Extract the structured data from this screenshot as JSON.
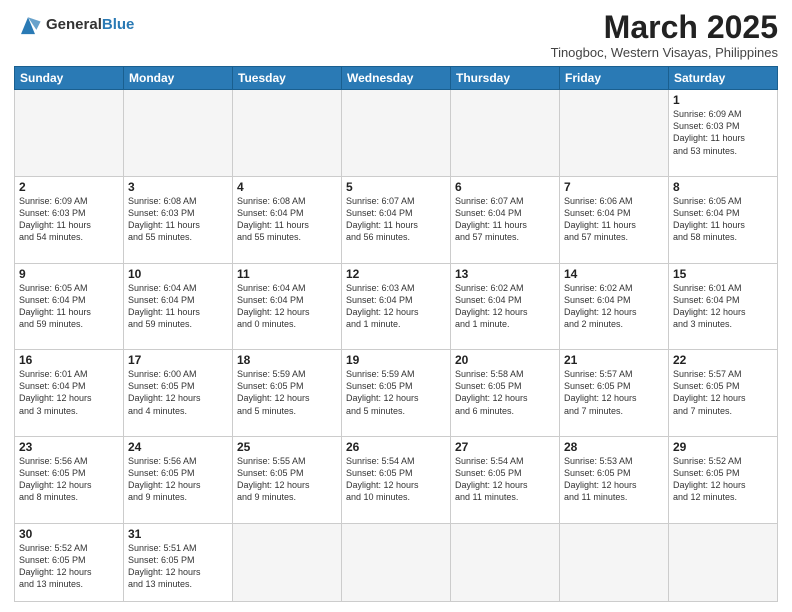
{
  "header": {
    "logo_text_normal": "General",
    "logo_text_blue": "Blue",
    "month_title": "March 2025",
    "subtitle": "Tinogboc, Western Visayas, Philippines"
  },
  "weekdays": [
    "Sunday",
    "Monday",
    "Tuesday",
    "Wednesday",
    "Thursday",
    "Friday",
    "Saturday"
  ],
  "weeks": [
    [
      {
        "day": "",
        "info": ""
      },
      {
        "day": "",
        "info": ""
      },
      {
        "day": "",
        "info": ""
      },
      {
        "day": "",
        "info": ""
      },
      {
        "day": "",
        "info": ""
      },
      {
        "day": "",
        "info": ""
      },
      {
        "day": "1",
        "info": "Sunrise: 6:09 AM\nSunset: 6:03 PM\nDaylight: 11 hours\nand 53 minutes."
      }
    ],
    [
      {
        "day": "2",
        "info": "Sunrise: 6:09 AM\nSunset: 6:03 PM\nDaylight: 11 hours\nand 54 minutes."
      },
      {
        "day": "3",
        "info": "Sunrise: 6:08 AM\nSunset: 6:03 PM\nDaylight: 11 hours\nand 55 minutes."
      },
      {
        "day": "4",
        "info": "Sunrise: 6:08 AM\nSunset: 6:04 PM\nDaylight: 11 hours\nand 55 minutes."
      },
      {
        "day": "5",
        "info": "Sunrise: 6:07 AM\nSunset: 6:04 PM\nDaylight: 11 hours\nand 56 minutes."
      },
      {
        "day": "6",
        "info": "Sunrise: 6:07 AM\nSunset: 6:04 PM\nDaylight: 11 hours\nand 57 minutes."
      },
      {
        "day": "7",
        "info": "Sunrise: 6:06 AM\nSunset: 6:04 PM\nDaylight: 11 hours\nand 57 minutes."
      },
      {
        "day": "8",
        "info": "Sunrise: 6:05 AM\nSunset: 6:04 PM\nDaylight: 11 hours\nand 58 minutes."
      }
    ],
    [
      {
        "day": "9",
        "info": "Sunrise: 6:05 AM\nSunset: 6:04 PM\nDaylight: 11 hours\nand 59 minutes."
      },
      {
        "day": "10",
        "info": "Sunrise: 6:04 AM\nSunset: 6:04 PM\nDaylight: 11 hours\nand 59 minutes."
      },
      {
        "day": "11",
        "info": "Sunrise: 6:04 AM\nSunset: 6:04 PM\nDaylight: 12 hours\nand 0 minutes."
      },
      {
        "day": "12",
        "info": "Sunrise: 6:03 AM\nSunset: 6:04 PM\nDaylight: 12 hours\nand 1 minute."
      },
      {
        "day": "13",
        "info": "Sunrise: 6:02 AM\nSunset: 6:04 PM\nDaylight: 12 hours\nand 1 minute."
      },
      {
        "day": "14",
        "info": "Sunrise: 6:02 AM\nSunset: 6:04 PM\nDaylight: 12 hours\nand 2 minutes."
      },
      {
        "day": "15",
        "info": "Sunrise: 6:01 AM\nSunset: 6:04 PM\nDaylight: 12 hours\nand 3 minutes."
      }
    ],
    [
      {
        "day": "16",
        "info": "Sunrise: 6:01 AM\nSunset: 6:04 PM\nDaylight: 12 hours\nand 3 minutes."
      },
      {
        "day": "17",
        "info": "Sunrise: 6:00 AM\nSunset: 6:05 PM\nDaylight: 12 hours\nand 4 minutes."
      },
      {
        "day": "18",
        "info": "Sunrise: 5:59 AM\nSunset: 6:05 PM\nDaylight: 12 hours\nand 5 minutes."
      },
      {
        "day": "19",
        "info": "Sunrise: 5:59 AM\nSunset: 6:05 PM\nDaylight: 12 hours\nand 5 minutes."
      },
      {
        "day": "20",
        "info": "Sunrise: 5:58 AM\nSunset: 6:05 PM\nDaylight: 12 hours\nand 6 minutes."
      },
      {
        "day": "21",
        "info": "Sunrise: 5:57 AM\nSunset: 6:05 PM\nDaylight: 12 hours\nand 7 minutes."
      },
      {
        "day": "22",
        "info": "Sunrise: 5:57 AM\nSunset: 6:05 PM\nDaylight: 12 hours\nand 7 minutes."
      }
    ],
    [
      {
        "day": "23",
        "info": "Sunrise: 5:56 AM\nSunset: 6:05 PM\nDaylight: 12 hours\nand 8 minutes."
      },
      {
        "day": "24",
        "info": "Sunrise: 5:56 AM\nSunset: 6:05 PM\nDaylight: 12 hours\nand 9 minutes."
      },
      {
        "day": "25",
        "info": "Sunrise: 5:55 AM\nSunset: 6:05 PM\nDaylight: 12 hours\nand 9 minutes."
      },
      {
        "day": "26",
        "info": "Sunrise: 5:54 AM\nSunset: 6:05 PM\nDaylight: 12 hours\nand 10 minutes."
      },
      {
        "day": "27",
        "info": "Sunrise: 5:54 AM\nSunset: 6:05 PM\nDaylight: 12 hours\nand 11 minutes."
      },
      {
        "day": "28",
        "info": "Sunrise: 5:53 AM\nSunset: 6:05 PM\nDaylight: 12 hours\nand 11 minutes."
      },
      {
        "day": "29",
        "info": "Sunrise: 5:52 AM\nSunset: 6:05 PM\nDaylight: 12 hours\nand 12 minutes."
      }
    ],
    [
      {
        "day": "30",
        "info": "Sunrise: 5:52 AM\nSunset: 6:05 PM\nDaylight: 12 hours\nand 13 minutes."
      },
      {
        "day": "31",
        "info": "Sunrise: 5:51 AM\nSunset: 6:05 PM\nDaylight: 12 hours\nand 13 minutes."
      },
      {
        "day": "",
        "info": ""
      },
      {
        "day": "",
        "info": ""
      },
      {
        "day": "",
        "info": ""
      },
      {
        "day": "",
        "info": ""
      },
      {
        "day": "",
        "info": ""
      }
    ]
  ]
}
